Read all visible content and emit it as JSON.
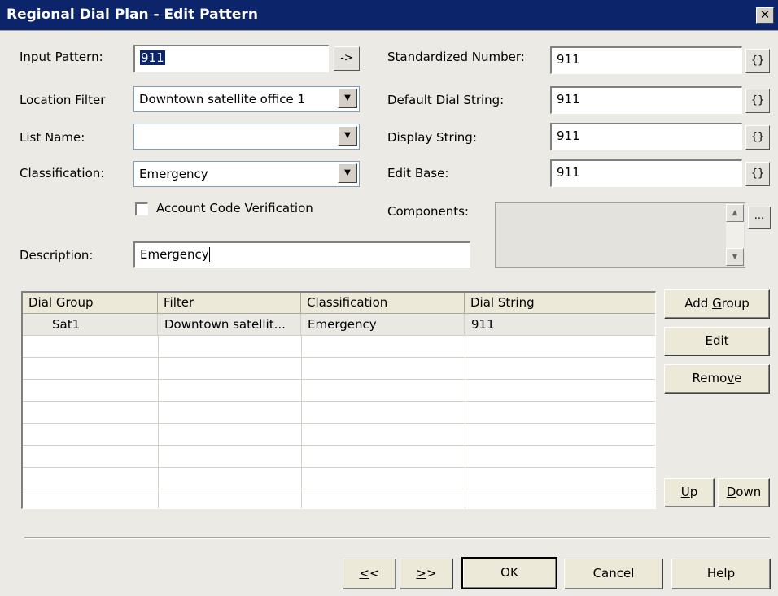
{
  "window": {
    "title": "Regional Dial Plan - Edit Pattern",
    "close_glyph": "✕"
  },
  "left": {
    "input_pattern_label": "Input Pattern:",
    "input_pattern_value": "911",
    "arrow_button": "->",
    "location_filter_label": "Location Filter",
    "location_filter_value": "Downtown satellite office 1",
    "list_name_label": "List Name:",
    "list_name_value": "",
    "classification_label": "Classification:",
    "classification_value": "Emergency",
    "account_code_label": "Account Code Verification",
    "account_code_checked": false,
    "description_label": "Description:",
    "description_value": "Emergency"
  },
  "right": {
    "standardized_label": "Standardized Number:",
    "standardized_value": "911",
    "default_dial_label": "Default Dial String:",
    "default_dial_value": "911",
    "display_string_label": "Display String:",
    "display_string_value": "911",
    "edit_base_label": "Edit Base:",
    "edit_base_value": "911",
    "brace_button": "{}",
    "components_label": "Components:",
    "components_browse": "..."
  },
  "grid": {
    "headers": [
      "Dial Group",
      "Filter",
      "Classification",
      "Dial String"
    ],
    "rows": [
      [
        "Sat1",
        "Downtown satellit...",
        "Emergency",
        "911"
      ]
    ]
  },
  "side_buttons": {
    "add_group_pre": "Add ",
    "add_group_u": "G",
    "add_group_post": "roup",
    "edit_u": "E",
    "edit_post": "dit",
    "remove_pre": "Remo",
    "remove_u": "v",
    "remove_post": "e",
    "up_u": "U",
    "up_post": "p",
    "down_u": "D",
    "down_post": "own"
  },
  "footer": {
    "prev_u": "<",
    "prev_post": "<",
    "next_u": ">",
    "next_post": ">",
    "ok": "OK",
    "cancel": "Cancel",
    "help": "Help"
  }
}
